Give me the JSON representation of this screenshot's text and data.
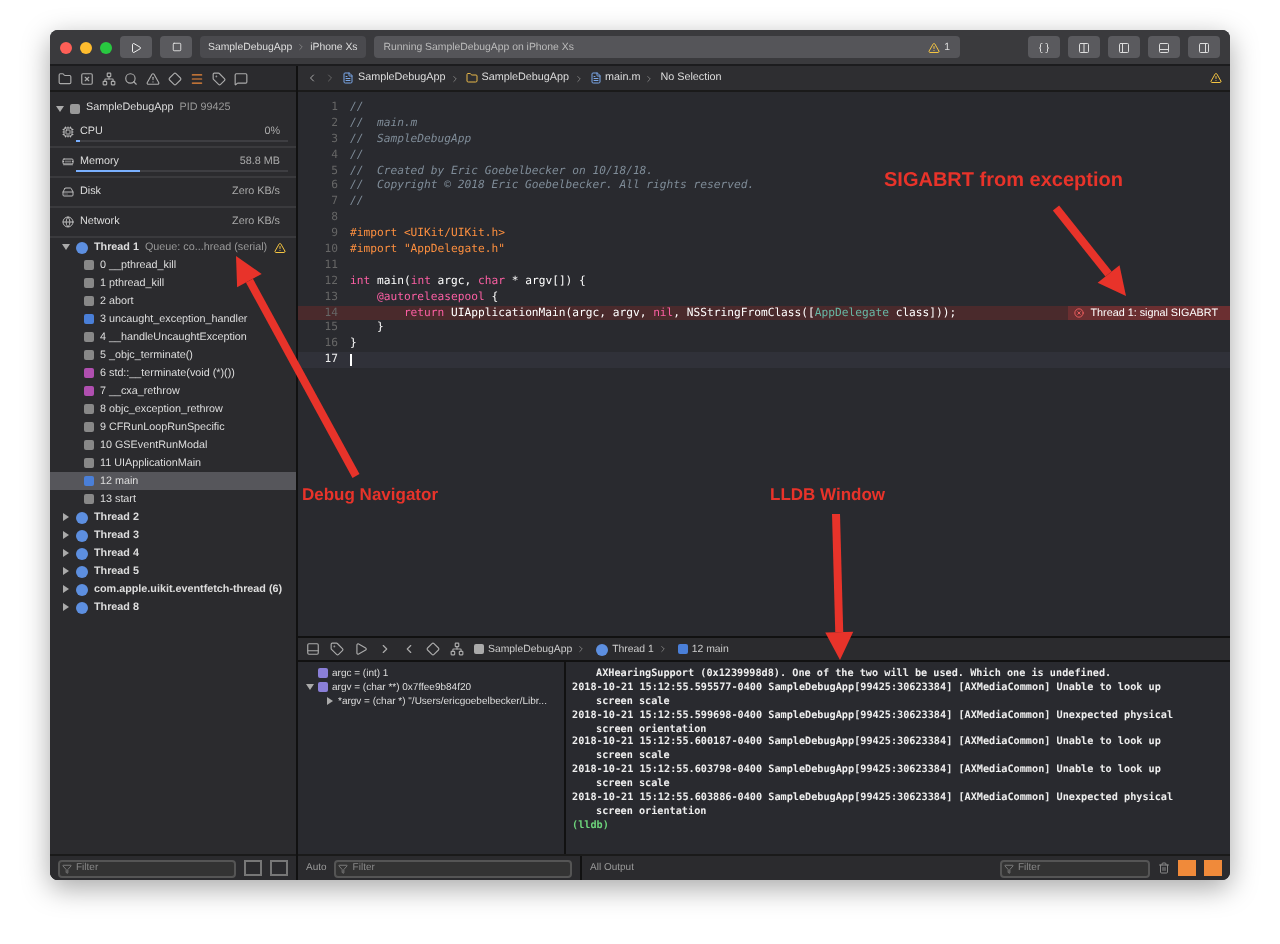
{
  "toolbar": {
    "scheme": "SampleDebugApp",
    "device": "iPhone Xs",
    "activity": "Running SampleDebugApp on iPhone Xs",
    "warning_count": "1"
  },
  "jump_bar": [
    "SampleDebugApp",
    "SampleDebugApp",
    "main.m",
    "No Selection"
  ],
  "navigator": {
    "process": {
      "name": "SampleDebugApp",
      "pid": "PID 99425"
    },
    "gauges": [
      {
        "name": "CPU",
        "value": "0%",
        "level": 0.02
      },
      {
        "name": "Memory",
        "value": "58.8 MB",
        "level": 0.3
      },
      {
        "name": "Disk",
        "value": "Zero KB/s"
      },
      {
        "name": "Network",
        "value": "Zero KB/s"
      }
    ],
    "threads": [
      {
        "name": "Thread 1",
        "queue": "Queue: co...hread (serial)",
        "expanded": true,
        "warning": true,
        "children": [
          {
            "label": "0 __pthread_kill",
            "selected": false
          },
          {
            "label": "1 pthread_kill",
            "selected": false
          },
          {
            "label": "2 abort",
            "selected": false
          },
          {
            "label": "3 uncaught_exception_handler",
            "selected": false
          },
          {
            "label": "4 __handleUncaughtException",
            "selected": false
          },
          {
            "label": "5 _objc_terminate()",
            "selected": false
          },
          {
            "label": "6 std::__terminate(void (*)())",
            "selected": false
          },
          {
            "label": "7 __cxa_rethrow",
            "selected": false
          },
          {
            "label": "8 objc_exception_rethrow",
            "selected": false
          },
          {
            "label": "9 CFRunLoopRunSpecific",
            "selected": false
          },
          {
            "label": "10 GSEventRunModal",
            "selected": false
          },
          {
            "label": "11 UIApplicationMain",
            "selected": false
          },
          {
            "label": "12 main",
            "selected": true
          },
          {
            "label": "13 start",
            "selected": false
          }
        ]
      },
      {
        "name": "Thread 2",
        "expanded": false,
        "warning": false
      },
      {
        "name": "Thread 3",
        "expanded": false,
        "warning": false
      },
      {
        "name": "Thread 4",
        "expanded": false,
        "warning": false
      },
      {
        "name": "Thread 5",
        "expanded": false,
        "warning": false
      },
      {
        "name": "com.apple.uikit.eventfetch-thread (6)",
        "expanded": false,
        "warning": false
      },
      {
        "name": "Thread 8",
        "expanded": false,
        "warning": false
      }
    ],
    "filter": {
      "placeholder": "Filter"
    }
  },
  "editor": {
    "lines": [
      {
        "number": "1",
        "tokens": [
          {
            "text": "//",
            "kind": "comment"
          }
        ]
      },
      {
        "number": "2",
        "tokens": [
          {
            "text": "//  main.m",
            "kind": "comment"
          }
        ]
      },
      {
        "number": "3",
        "tokens": [
          {
            "text": "//  SampleDebugApp",
            "kind": "comment"
          }
        ]
      },
      {
        "number": "4",
        "tokens": [
          {
            "text": "//",
            "kind": "comment"
          }
        ]
      },
      {
        "number": "5",
        "tokens": [
          {
            "text": "//  Created by Eric Goebelbecker on 10/18/18.",
            "kind": "comment"
          }
        ]
      },
      {
        "number": "6",
        "tokens": [
          {
            "text": "//  Copyright © 2018 Eric Goebelbecker. All rights reserved.",
            "kind": "comment"
          }
        ]
      },
      {
        "number": "7",
        "tokens": [
          {
            "text": "//",
            "kind": "comment"
          }
        ]
      },
      {
        "number": "8"
      },
      {
        "number": "9",
        "tokens": [
          {
            "text": "#import <UIKit/UIKit.h>",
            "kind": "directive"
          }
        ]
      },
      {
        "number": "10",
        "tokens": [
          {
            "text": "#import \"AppDelegate.h\"",
            "kind": "directive"
          }
        ]
      },
      {
        "number": "11"
      },
      {
        "number": "12",
        "tokens": [
          {
            "text": "int",
            "kind": "keyword"
          },
          {
            "text": " main(",
            "kind": "plain"
          },
          {
            "text": "int",
            "kind": "keyword"
          },
          {
            "text": " argc, ",
            "kind": "plain"
          },
          {
            "text": "char",
            "kind": "keyword"
          },
          {
            "text": " * argv[]) {",
            "kind": "plain"
          }
        ]
      },
      {
        "number": "13",
        "tokens": [
          {
            "text": "    @autoreleasepool",
            "kind": "keyword"
          },
          {
            "text": " {",
            "kind": "plain"
          }
        ]
      },
      {
        "number": "14",
        "error": "Thread 1: signal SIGABRT",
        "tokens": [
          {
            "text": "        return",
            "kind": "keyword"
          },
          {
            "text": " UIApplicationMain(argc, argv, ",
            "kind": "plain"
          },
          {
            "text": "nil",
            "kind": "keyword"
          },
          {
            "text": ", NSStringFromClass([",
            "kind": "plain"
          },
          {
            "text": "AppDelegate",
            "kind": "class"
          },
          {
            "text": " class]));",
            "kind": "plain"
          }
        ]
      },
      {
        "number": "15",
        "tokens": [
          {
            "text": "    }",
            "kind": "plain"
          }
        ]
      },
      {
        "number": "16",
        "tokens": [
          {
            "text": "}",
            "kind": "plain"
          }
        ]
      },
      {
        "number": "17",
        "current": true
      }
    ]
  },
  "debug_bar": {
    "path": [
      "SampleDebugApp",
      "Thread 1",
      "12 main"
    ]
  },
  "variables": [
    {
      "text": "argc = (int) 1"
    },
    {
      "text": "argv = (char **) 0x7ffee9b84f20",
      "expanded": true,
      "children": [
        {
          "text": "*argv = (char *) \"/Users/ericgoebelbecker/Libr..."
        }
      ]
    }
  ],
  "console": {
    "lines": [
      {
        "kind": "cont",
        "text": "AXHearingSupport (0x1239998d8). One of the two will be used. Which one is undefined."
      },
      {
        "kind": "log",
        "text": "2018-10-21 15:12:55.595577-0400 SampleDebugApp[99425:30623384] [AXMediaCommon] Unable to look up"
      },
      {
        "kind": "cont",
        "text": "screen scale"
      },
      {
        "kind": "log",
        "text": "2018-10-21 15:12:55.599698-0400 SampleDebugApp[99425:30623384] [AXMediaCommon] Unexpected physical"
      },
      {
        "kind": "cont",
        "text": "screen orientation"
      },
      {
        "kind": "log",
        "text": "2018-10-21 15:12:55.600187-0400 SampleDebugApp[99425:30623384] [AXMediaCommon] Unable to look up"
      },
      {
        "kind": "cont",
        "text": "screen scale"
      },
      {
        "kind": "log",
        "text": "2018-10-21 15:12:55.603798-0400 SampleDebugApp[99425:30623384] [AXMediaCommon] Unable to look up"
      },
      {
        "kind": "cont",
        "text": "screen scale"
      },
      {
        "kind": "log",
        "text": "2018-10-21 15:12:55.603886-0400 SampleDebugApp[99425:30623384] [AXMediaCommon] Unexpected physical"
      },
      {
        "kind": "cont",
        "text": "screen orientation"
      },
      {
        "kind": "prompt",
        "text": "(lldb)"
      }
    ]
  },
  "bottom_bar": {
    "variables_scope": "Auto",
    "variables_filter": {
      "placeholder": "Filter"
    },
    "output_scope": "All Output",
    "console_filter": {
      "placeholder": "Filter"
    }
  },
  "annotations": [
    {
      "text": "SIGABRT from exception"
    },
    {
      "text": "Debug Navigator"
    },
    {
      "text": "LLDB Window"
    }
  ]
}
